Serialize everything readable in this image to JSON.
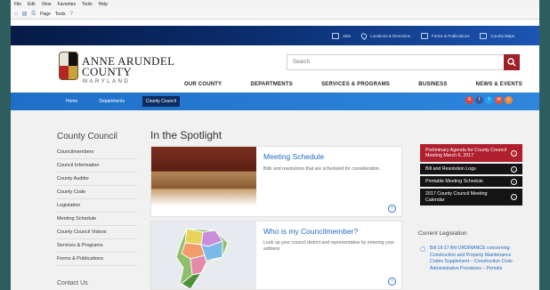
{
  "browser": {
    "menu": [
      "File",
      "Edit",
      "View",
      "Favorites",
      "Tools",
      "Help"
    ],
    "commands": [
      "Page",
      "Tools"
    ]
  },
  "utility_bar": {
    "items": [
      {
        "label": "Jobs",
        "icon": "briefcase-icon"
      },
      {
        "label": "Locations & Directions",
        "icon": "map-pin-icon"
      },
      {
        "label": "Forms & Publications",
        "icon": "document-icon"
      },
      {
        "label": "County Maps",
        "icon": "map-icon"
      }
    ]
  },
  "brand": {
    "name_line1": "ANNE ARUNDEL",
    "name_line2": "COUNTY",
    "subtitle": "MARYLAND",
    "seal_icon": "county-seal-icon"
  },
  "search": {
    "placeholder": "Search"
  },
  "main_nav": [
    "OUR COUNTY",
    "DEPARTMENTS",
    "SERVICES & PROGRAMS",
    "BUSINESS",
    "NEWS & EVENTS"
  ],
  "breadcrumb_nav": {
    "tabs": [
      "Home",
      "Departments",
      "County Council"
    ],
    "active_index": 2
  },
  "social": [
    "G",
    "f",
    "t",
    "✉",
    "+"
  ],
  "sidebar": {
    "title": "County Council",
    "items": [
      "Councilmembers",
      "Council Information",
      "County Auditor",
      "County Code",
      "Legislation",
      "Meeting Schedule",
      "County Council Videos",
      "Services & Programs",
      "Forms & Publications"
    ],
    "contact": "Contact Us"
  },
  "spotlight": {
    "title": "In the Spotlight",
    "cards": [
      {
        "title": "Meeting Schedule",
        "description": "Bills and resolutions that are scheduled for consideration.",
        "image": "gavel-image"
      },
      {
        "title": "Who is my Councilmember?",
        "description": "Look up your council district and representative by entering your address",
        "image": "district-map-image"
      }
    ]
  },
  "quick_links": [
    {
      "label": "Preliminary Agenda for County Council Meeting March 6, 2017",
      "style": "red"
    },
    {
      "label": "Bill and Resolution Logs",
      "style": "dark"
    },
    {
      "label": "Printable Meeting Schedule",
      "style": "dark"
    },
    {
      "label": "2017 County Council Meeting Calendar",
      "style": "dark"
    }
  ],
  "legislation": {
    "title": "Current Legislation",
    "items": [
      "Bill 19-17 AN ORDINANCE concerning: Construction and Property Maintenance Codes Supplement – Construction Code Administrative Provisions – Permits"
    ]
  },
  "colors": {
    "brand_blue": "#1e6fc7",
    "dark_navy": "#0a2d6c",
    "accent_red": "#b01f2e"
  }
}
